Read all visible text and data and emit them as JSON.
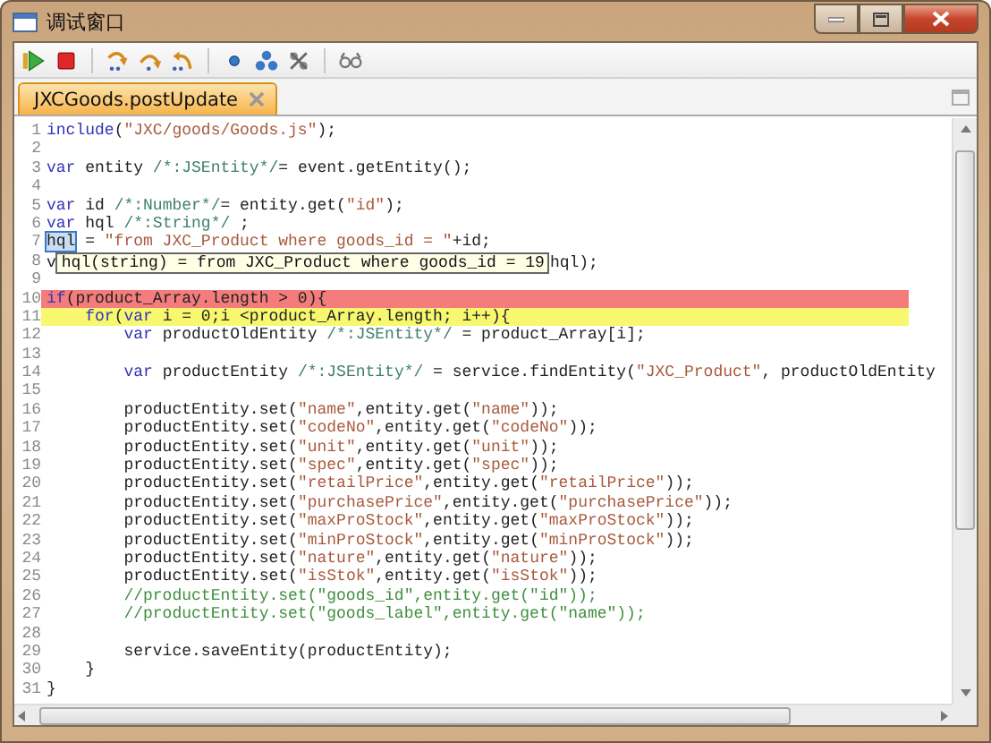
{
  "window": {
    "title": "调试窗口"
  },
  "tabs": [
    {
      "label": "JXCGoods.postUpdate",
      "selected": true
    }
  ],
  "editor": {
    "lines": [
      {
        "number": "1",
        "segments": [
          {
            "kind": "keyword",
            "text": "include"
          },
          {
            "kind": "plain",
            "text": "("
          },
          {
            "kind": "string",
            "text": "\"JXC/goods/Goods.js\""
          },
          {
            "kind": "plain",
            "text": ");"
          }
        ]
      },
      {
        "number": "2"
      },
      {
        "number": "3",
        "segments": [
          {
            "kind": "keyword",
            "text": "var"
          },
          {
            "kind": "plain",
            "text": " entity "
          },
          {
            "kind": "comment",
            "text": "/*:JSEntity*/"
          },
          {
            "kind": "plain",
            "text": "= event.getEntity();"
          }
        ]
      },
      {
        "number": "4"
      },
      {
        "number": "5",
        "segments": [
          {
            "kind": "keyword",
            "text": "var"
          },
          {
            "kind": "plain",
            "text": " id "
          },
          {
            "kind": "comment",
            "text": "/*:Number*/"
          },
          {
            "kind": "plain",
            "text": "= entity.get("
          },
          {
            "kind": "string",
            "text": "\"id\""
          },
          {
            "kind": "plain",
            "text": ");"
          }
        ]
      },
      {
        "number": "6",
        "segments": [
          {
            "kind": "keyword",
            "text": "var"
          },
          {
            "kind": "plain",
            "text": " hql "
          },
          {
            "kind": "comment",
            "text": "/*:String*/"
          },
          {
            "kind": "plain",
            "text": " ;"
          }
        ]
      },
      {
        "number": "7",
        "segments": [
          {
            "kind": "plain",
            "text": "hql",
            "selected": true
          },
          {
            "kind": "plain",
            "text": " = "
          },
          {
            "kind": "string",
            "text": "\"from JXC_Product where goods_id = \""
          },
          {
            "kind": "plain",
            "text": "+id;"
          }
        ]
      },
      {
        "number": "8",
        "segments": [
          {
            "kind": "plain",
            "text": "v"
          },
          {
            "kind": "tooltip",
            "text": "hql(string) = from JXC_Product where goods_id = 19"
          },
          {
            "kind": "plain",
            "text": "hql);"
          }
        ]
      },
      {
        "number": "9"
      },
      {
        "number": "10",
        "kind": "breakpoint",
        "segments": [
          {
            "kind": "keyword",
            "text": "if"
          },
          {
            "kind": "plain",
            "text": "(product_Array.length > 0){"
          }
        ]
      },
      {
        "number": "11",
        "kind": "current",
        "segments": [
          {
            "kind": "keyword",
            "text": "    for"
          },
          {
            "kind": "plain",
            "text": "("
          },
          {
            "kind": "keyword",
            "text": "var"
          },
          {
            "kind": "plain",
            "text": " i = 0;i <product_Array.length; i++){"
          }
        ]
      },
      {
        "number": "12",
        "segments": [
          {
            "kind": "keyword",
            "text": "        var"
          },
          {
            "kind": "plain",
            "text": " productOldEntity "
          },
          {
            "kind": "comment",
            "text": "/*:JSEntity*/"
          },
          {
            "kind": "plain",
            "text": " = product_Array[i];"
          }
        ]
      },
      {
        "number": "13"
      },
      {
        "number": "14",
        "segments": [
          {
            "kind": "keyword",
            "text": "        var"
          },
          {
            "kind": "plain",
            "text": " productEntity "
          },
          {
            "kind": "comment",
            "text": "/*:JSEntity*/"
          },
          {
            "kind": "plain",
            "text": " = service.findEntity("
          },
          {
            "kind": "string",
            "text": "\"JXC_Product\""
          },
          {
            "kind": "plain",
            "text": ", productOldEntity"
          }
        ]
      },
      {
        "number": "15"
      },
      {
        "number": "16",
        "segments": [
          {
            "kind": "plain",
            "text": "        productEntity.set("
          },
          {
            "kind": "string",
            "text": "\"name\""
          },
          {
            "kind": "plain",
            "text": ",entity.get("
          },
          {
            "kind": "string",
            "text": "\"name\""
          },
          {
            "kind": "plain",
            "text": "));"
          }
        ]
      },
      {
        "number": "17",
        "segments": [
          {
            "kind": "plain",
            "text": "        productEntity.set("
          },
          {
            "kind": "string",
            "text": "\"codeNo\""
          },
          {
            "kind": "plain",
            "text": ",entity.get("
          },
          {
            "kind": "string",
            "text": "\"codeNo\""
          },
          {
            "kind": "plain",
            "text": "));"
          }
        ]
      },
      {
        "number": "18",
        "segments": [
          {
            "kind": "plain",
            "text": "        productEntity.set("
          },
          {
            "kind": "string",
            "text": "\"unit\""
          },
          {
            "kind": "plain",
            "text": ",entity.get("
          },
          {
            "kind": "string",
            "text": "\"unit\""
          },
          {
            "kind": "plain",
            "text": "));"
          }
        ]
      },
      {
        "number": "19",
        "segments": [
          {
            "kind": "plain",
            "text": "        productEntity.set("
          },
          {
            "kind": "string",
            "text": "\"spec\""
          },
          {
            "kind": "plain",
            "text": ",entity.get("
          },
          {
            "kind": "string",
            "text": "\"spec\""
          },
          {
            "kind": "plain",
            "text": "));"
          }
        ]
      },
      {
        "number": "20",
        "segments": [
          {
            "kind": "plain",
            "text": "        productEntity.set("
          },
          {
            "kind": "string",
            "text": "\"retailPrice\""
          },
          {
            "kind": "plain",
            "text": ",entity.get("
          },
          {
            "kind": "string",
            "text": "\"retailPrice\""
          },
          {
            "kind": "plain",
            "text": "));"
          }
        ]
      },
      {
        "number": "21",
        "segments": [
          {
            "kind": "plain",
            "text": "        productEntity.set("
          },
          {
            "kind": "string",
            "text": "\"purchasePrice\""
          },
          {
            "kind": "plain",
            "text": ",entity.get("
          },
          {
            "kind": "string",
            "text": "\"purchasePrice\""
          },
          {
            "kind": "plain",
            "text": "));"
          }
        ]
      },
      {
        "number": "22",
        "segments": [
          {
            "kind": "plain",
            "text": "        productEntity.set("
          },
          {
            "kind": "string",
            "text": "\"maxProStock\""
          },
          {
            "kind": "plain",
            "text": ",entity.get("
          },
          {
            "kind": "string",
            "text": "\"maxProStock\""
          },
          {
            "kind": "plain",
            "text": "));"
          }
        ]
      },
      {
        "number": "23",
        "segments": [
          {
            "kind": "plain",
            "text": "        productEntity.set("
          },
          {
            "kind": "string",
            "text": "\"minProStock\""
          },
          {
            "kind": "plain",
            "text": ",entity.get("
          },
          {
            "kind": "string",
            "text": "\"minProStock\""
          },
          {
            "kind": "plain",
            "text": "));"
          }
        ]
      },
      {
        "number": "24",
        "segments": [
          {
            "kind": "plain",
            "text": "        productEntity.set("
          },
          {
            "kind": "string",
            "text": "\"nature\""
          },
          {
            "kind": "plain",
            "text": ",entity.get("
          },
          {
            "kind": "string",
            "text": "\"nature\""
          },
          {
            "kind": "plain",
            "text": "));"
          }
        ]
      },
      {
        "number": "25",
        "segments": [
          {
            "kind": "plain",
            "text": "        productEntity.set("
          },
          {
            "kind": "string",
            "text": "\"isStok\""
          },
          {
            "kind": "plain",
            "text": ",entity.get("
          },
          {
            "kind": "string",
            "text": "\"isStok\""
          },
          {
            "kind": "plain",
            "text": "));"
          }
        ]
      },
      {
        "number": "26",
        "segments": [
          {
            "kind": "line-comment",
            "text": "        //productEntity.set(\"goods_id\",entity.get(\"id\"));"
          }
        ]
      },
      {
        "number": "27",
        "segments": [
          {
            "kind": "line-comment",
            "text": "        //productEntity.set(\"goods_label\",entity.get(\"name\"));"
          }
        ]
      },
      {
        "number": "28"
      },
      {
        "number": "29",
        "segments": [
          {
            "kind": "plain",
            "text": "        service.saveEntity(productEntity);"
          }
        ]
      },
      {
        "number": "30",
        "segments": [
          {
            "kind": "plain",
            "text": "    }"
          }
        ]
      },
      {
        "number": "31",
        "segments": [
          {
            "kind": "plain",
            "text": "}"
          }
        ]
      }
    ]
  }
}
